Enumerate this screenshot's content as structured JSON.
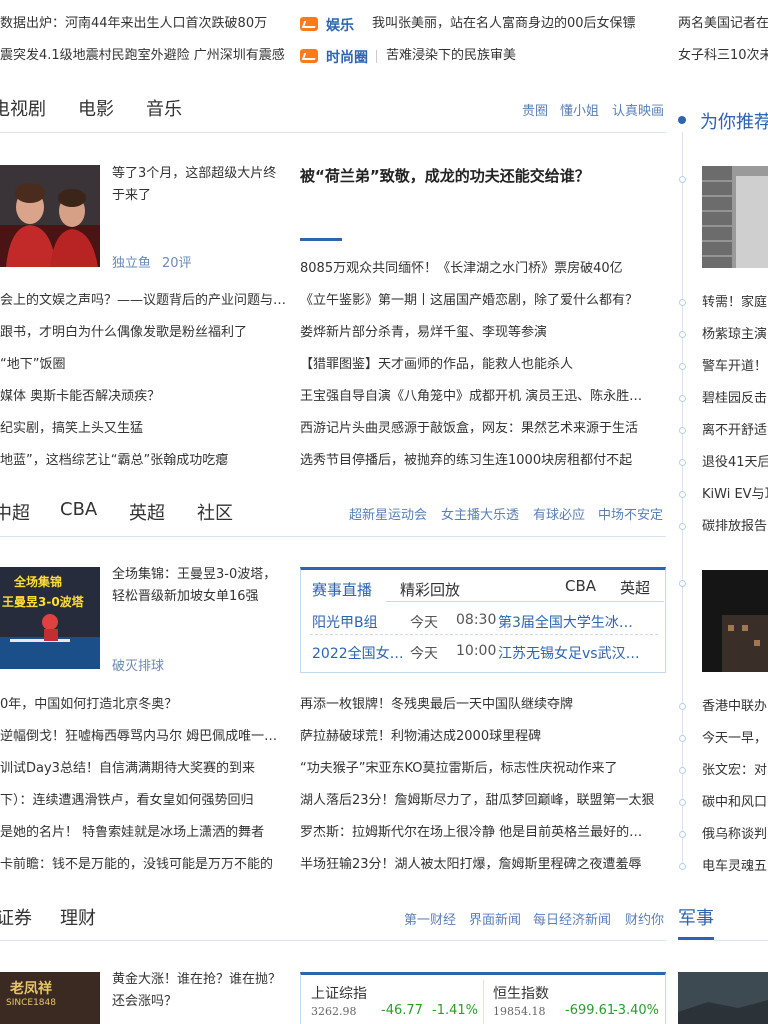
{
  "ticker": {
    "left": [
      "数据出炉：河南44年来出生人口首次跌破80万",
      "震突发4.1级地震村民跑室外避险 广州深圳有震感"
    ],
    "mid": [
      {
        "tag": "娱乐",
        "text": "我叫张美丽，站在名人富商身边的00后女保镖"
      },
      {
        "tag": "时尚圈",
        "text": "苦难浸染下的民族审美"
      }
    ],
    "right": [
      "两名美国记者在",
      "女子科三10次未"
    ]
  },
  "ent": {
    "tabs": [
      "电视剧",
      "电影",
      "音乐"
    ],
    "links": [
      "贵圈",
      "懂小姐",
      "认真映画"
    ],
    "card_text": "等了3个月，这部超级大片终于来了",
    "card_text_l1": "等了3个月，这部超级大片终",
    "card_text_l2": "于来了",
    "card_source": "独立鱼",
    "card_comments": "20评",
    "headline": "被“荷兰弟”致敬，成龙的功夫还能交给谁？",
    "left_list": [
      "会上的文娱之声吗？——议题背后的产业问题与…",
      "跟书，才明白为什么偶像发歌是粉丝福利了",
      "“地下”饭圈",
      "媒体 奥斯卡能否解决顽疾？",
      "纪实剧，搞笑上头又生猛",
      "地蓝”，这档综艺让“霸总”张翰成功吃瘪"
    ],
    "right_list": [
      "8085万观众共同缅怀！《长津湖之水门桥》票房破40亿",
      "《立午鉴影》第一期丨这届国产婚恋剧，除了爱什么都有？",
      "娄烨新片部分杀青，易烊千玺、李现等参演",
      "【猎罪图鉴】天才画师的作品，能救人也能杀人",
      "王宝强自导自演《八角笼中》成都开机 演员王迅、陈永胜…",
      "西游记片头曲灵感源于敲饭盒，网友：果然艺术来源于生活",
      "选秀节目停播后，被抛弃的练习生连1000块房租都付不起"
    ]
  },
  "sports": {
    "tabs": [
      "中超",
      "CBA",
      "英超",
      "社区"
    ],
    "links": [
      "超新星运动会",
      "女主播大乐透",
      "有球必应",
      "中场不安定"
    ],
    "card_text": "全场集锦：王曼昱3-0波塔，轻松晋级新加坡女单16强",
    "card_text_l1": "全场集锦：王曼昱3-0波塔，",
    "card_text_l2": "轻松晋级新加坡女单16强",
    "card_source": "破灭排球",
    "thumb_banner_1": "全场集锦",
    "thumb_banner_2": "王曼昱3-0波塔",
    "live": {
      "tabs": [
        "赛事直播",
        "精彩回放"
      ],
      "leagues": [
        "CBA",
        "英超"
      ],
      "rows": [
        {
          "league": "阳光甲B组",
          "day": "今天",
          "time": "08:30",
          "title": "第3届全国大学生冰…"
        },
        {
          "league": "2022全国女…",
          "day": "今天",
          "time": "10:00",
          "title": "江苏无锡女足vs武汉…"
        }
      ]
    },
    "left_list": [
      "0年，中国如何打造北京冬奥？",
      "逆幅倒戈！狂嘘梅西辱骂内马尔 姆巴佩成唯一…",
      "训试Day3总结！自信满满期待大奖赛的到来",
      "下）：连续遭遇滑铁卢，看女皇如何强势回归",
      "是她的名片！ 特鲁索娃就是冰场上潇洒的舞者",
      "卡前瞻：钱不是万能的，没钱可能是万万不能的"
    ],
    "right_list": [
      "再添一枚银牌！冬残奥最后一天中国队继续夺牌",
      "萨拉赫破球荒！利物浦达成2000球里程碑",
      "“功夫猴子”宋亚东KO莫拉雷斯后，标志性庆祝动作来了",
      "湖人落后23分！詹姆斯尽力了，甜瓜梦回巅峰，联盟第一太狠",
      "罗杰斯：拉姆斯代尔在场上很冷静 他是目前英格兰最好的…",
      "半场狂输23分！湖人被太阳打爆，詹姆斯里程碑之夜遭羞辱"
    ]
  },
  "finance": {
    "tabs": [
      "证券",
      "理财"
    ],
    "links": [
      "第一财经",
      "界面新闻",
      "每日经济新闻",
      "财约你"
    ],
    "card_text": "黄金大涨！谁在抢？谁在抛？还会涨吗？",
    "card_text_l1": "黄金大涨！谁在抢？谁在抛？",
    "card_text_l2": "还会涨吗？",
    "thumb_text_1": "老凤祥",
    "thumb_text_2": "SINCE1848",
    "stocks": [
      {
        "name": "上证综指",
        "value": "3262.98",
        "change": "-46.77",
        "pct": "-1.41%"
      },
      {
        "name": "恒生指数",
        "value": "19854.18",
        "change": "-699.61",
        "pct": "-3.40%"
      }
    ]
  },
  "sidebar": {
    "title": "为你推荐",
    "items_a": [
      "转需！家庭",
      "杨紫琼主演",
      "警车开道！",
      "碧桂园反击",
      "离不开舒适",
      "退役41天后",
      "KiWi EV与耳",
      "碳排放报告"
    ],
    "items_b": [
      "香港中联办",
      "今天一早，",
      "张文宏：对",
      "碳中和风口",
      "俄乌称谈判",
      "电车灵魂五"
    ],
    "military": "军事"
  },
  "colors": {
    "accent": "#2d64b3",
    "tag_orange": "#ff7a1a",
    "down_green": "#2a9d2a"
  }
}
